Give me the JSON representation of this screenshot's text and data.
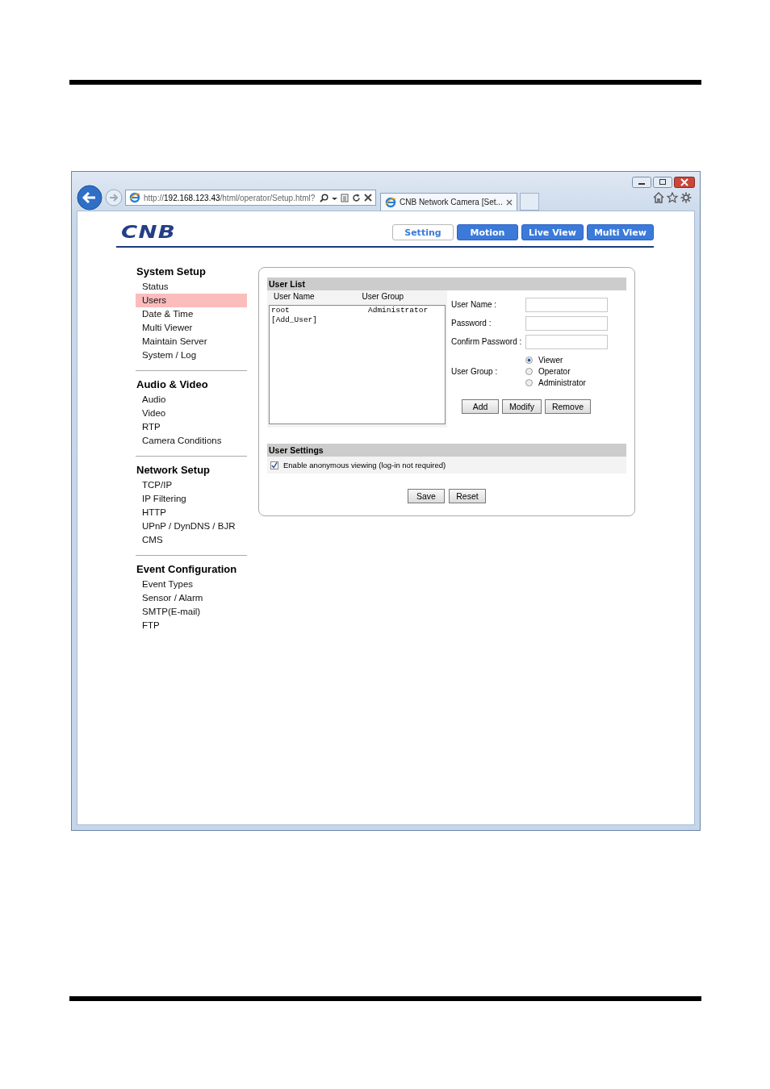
{
  "browser": {
    "address": {
      "prefix": "http://",
      "host": "192.168.123.43",
      "path": "/html/operator/Setup.html?"
    },
    "tab_title": "CNB Network Camera [Set..."
  },
  "header": {
    "logo": "CNB",
    "nav": [
      {
        "label": "Setting",
        "selected": true
      },
      {
        "label": "Motion",
        "selected": false
      },
      {
        "label": "Live View",
        "selected": false
      },
      {
        "label": "Multi View",
        "selected": false
      }
    ]
  },
  "sidebar": {
    "sections": [
      {
        "title": "System Setup",
        "items": [
          {
            "label": "Status",
            "selected": false
          },
          {
            "label": "Users",
            "selected": true
          },
          {
            "label": "Date & Time",
            "selected": false
          },
          {
            "label": "Multi Viewer",
            "selected": false
          },
          {
            "label": "Maintain Server",
            "selected": false
          },
          {
            "label": "System / Log",
            "selected": false
          }
        ]
      },
      {
        "title": "Audio & Video",
        "items": [
          {
            "label": "Audio",
            "selected": false
          },
          {
            "label": "Video",
            "selected": false
          },
          {
            "label": "RTP",
            "selected": false
          },
          {
            "label": "Camera Conditions",
            "selected": false
          }
        ]
      },
      {
        "title": "Network Setup",
        "items": [
          {
            "label": "TCP/IP",
            "selected": false
          },
          {
            "label": "IP Filtering",
            "selected": false
          },
          {
            "label": "HTTP",
            "selected": false
          },
          {
            "label": "UPnP / DynDNS / BJR",
            "selected": false
          },
          {
            "label": "CMS",
            "selected": false
          }
        ]
      },
      {
        "title": "Event Configuration",
        "items": [
          {
            "label": "Event Types",
            "selected": false
          },
          {
            "label": "Sensor / Alarm",
            "selected": false
          },
          {
            "label": "SMTP(E-mail)",
            "selected": false
          },
          {
            "label": "FTP",
            "selected": false
          }
        ]
      }
    ]
  },
  "user_list": {
    "title": "User List",
    "columns": [
      "User Name",
      "User Group"
    ],
    "rows": [
      {
        "user_name": "root",
        "user_group": "Administrator"
      },
      {
        "user_name": "[Add_User]",
        "user_group": ""
      }
    ],
    "fields": [
      {
        "label": "User Name :"
      },
      {
        "label": "Password :"
      },
      {
        "label": "Confirm Password :"
      }
    ],
    "group_label": "User Group :",
    "groups": [
      {
        "label": "Viewer",
        "selected": true
      },
      {
        "label": "Operator",
        "selected": false
      },
      {
        "label": "Administrator",
        "selected": false
      }
    ],
    "buttons": [
      "Add",
      "Modify",
      "Remove"
    ]
  },
  "user_settings": {
    "title": "User Settings",
    "anonymous": {
      "label": "Enable anonymous viewing (log-in not required)",
      "checked": true
    },
    "buttons": [
      "Save",
      "Reset"
    ]
  }
}
